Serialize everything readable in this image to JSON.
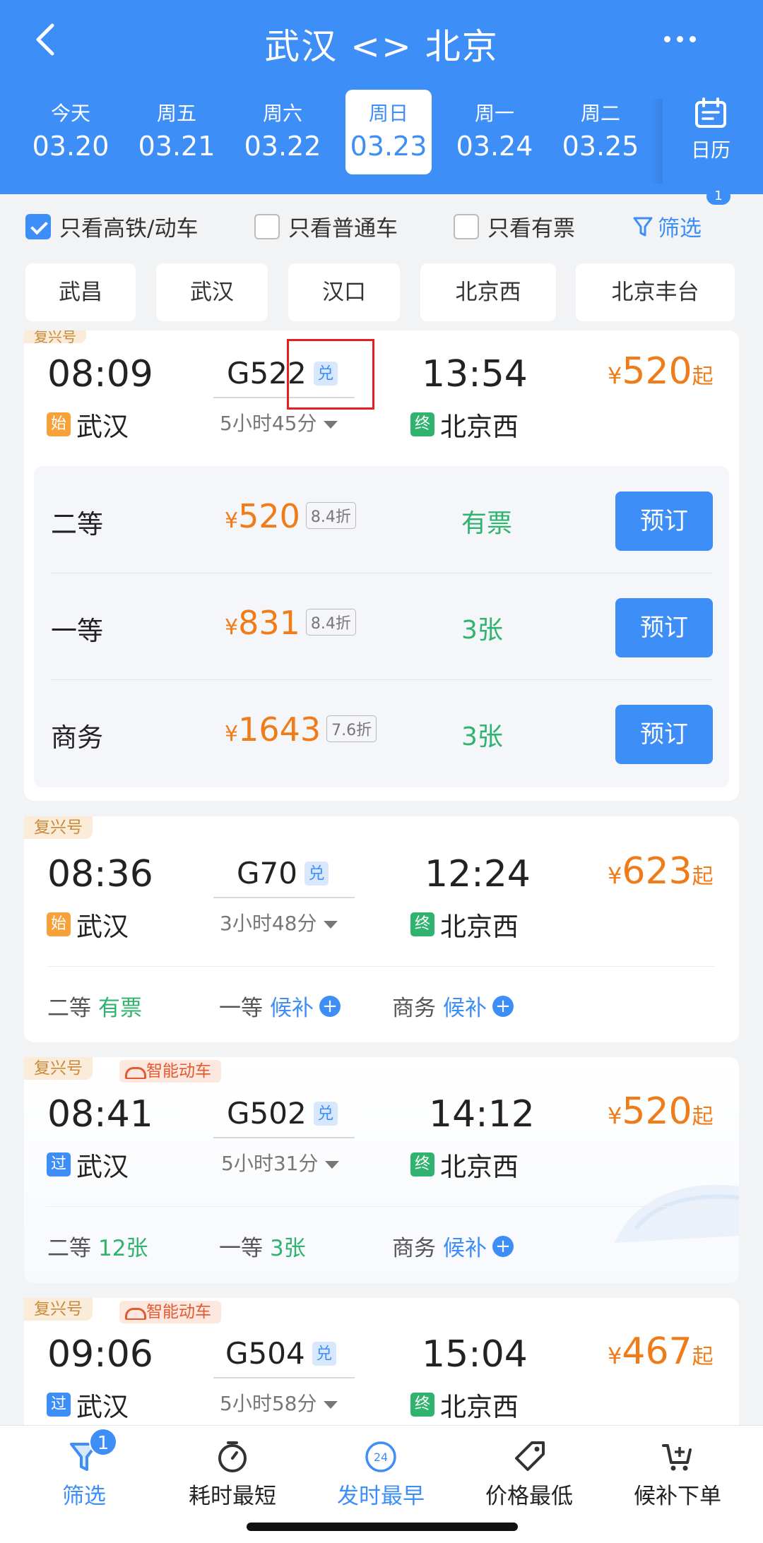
{
  "header": {
    "title": "武汉 <> 北京",
    "dates": [
      {
        "weekday": "今天",
        "date": "03.20"
      },
      {
        "weekday": "周五",
        "date": "03.21"
      },
      {
        "weekday": "周六",
        "date": "03.22"
      },
      {
        "weekday": "周日",
        "date": "03.23"
      },
      {
        "weekday": "周一",
        "date": "03.24"
      },
      {
        "weekday": "周二",
        "date": "03.25"
      }
    ],
    "selected_index": 3,
    "calendar_label": "日历"
  },
  "filters": {
    "high_speed_only": "只看高铁/动车",
    "normal_only": "只看普通车",
    "available_only": "只看有票",
    "filter_label": "筛选",
    "filter_count": "1"
  },
  "stations": [
    "武昌",
    "武汉",
    "汉口",
    "北京西",
    "北京丰台"
  ],
  "trains": [
    {
      "tags": [
        "复兴号"
      ],
      "depart_time": "08:09",
      "train_no": "G522",
      "exchange": "兑",
      "arrive_time": "13:54",
      "duration": "5小时45分",
      "from_badge": "始",
      "from": "武汉",
      "to_badge": "终",
      "to": "北京西",
      "price_yen": "¥",
      "price": "520",
      "price_suffix": "起",
      "seats": [
        {
          "name": "二等",
          "yen": "¥",
          "price": "520",
          "discount": "8.4折",
          "status": "有票",
          "action": "预订"
        },
        {
          "name": "一等",
          "yen": "¥",
          "price": "831",
          "discount": "8.4折",
          "status": "3张",
          "action": "预订"
        },
        {
          "name": "商务",
          "yen": "¥",
          "price": "1643",
          "discount": "7.6折",
          "status": "3张",
          "action": "预订"
        }
      ]
    },
    {
      "tags": [
        "复兴号"
      ],
      "depart_time": "08:36",
      "train_no": "G70",
      "exchange": "兑",
      "arrive_time": "12:24",
      "duration": "3小时48分",
      "from_badge": "始",
      "from": "武汉",
      "to_badge": "终",
      "to": "北京西",
      "price_yen": "¥",
      "price": "623",
      "price_suffix": "起",
      "summary": [
        {
          "class": "二等",
          "status": "有票"
        },
        {
          "class": "一等",
          "status": "候补"
        },
        {
          "class": "商务",
          "status": "候补"
        }
      ]
    },
    {
      "tags": [
        "复兴号",
        "智能动车"
      ],
      "depart_time": "08:41",
      "train_no": "G502",
      "exchange": "兑",
      "arrive_time": "14:12",
      "duration": "5小时31分",
      "from_badge": "过",
      "from": "武汉",
      "to_badge": "终",
      "to": "北京西",
      "price_yen": "¥",
      "price": "520",
      "price_suffix": "起",
      "summary": [
        {
          "class": "二等",
          "status": "12张"
        },
        {
          "class": "一等",
          "status": "3张"
        },
        {
          "class": "商务",
          "status": "候补"
        }
      ]
    },
    {
      "tags": [
        "复兴号",
        "智能动车"
      ],
      "depart_time": "09:06",
      "train_no": "G504",
      "exchange": "兑",
      "arrive_time": "15:04",
      "duration": "5小时58分",
      "from_badge": "过",
      "from": "武汉",
      "to_badge": "终",
      "to": "北京西",
      "price_yen": "¥",
      "price": "467",
      "price_suffix": "起"
    }
  ],
  "tabbar": {
    "badge": "1",
    "tabs": [
      {
        "label": "筛选",
        "icon": "filter-icon"
      },
      {
        "label": "耗时最短",
        "icon": "timer-icon"
      },
      {
        "label": "发时最早",
        "icon": "clock-24-icon"
      },
      {
        "label": "价格最低",
        "icon": "price-tag-icon"
      },
      {
        "label": "候补下单",
        "icon": "cart-icon"
      }
    ]
  },
  "colors": {
    "brand_blue": "#3e8ef7",
    "price_orange": "#f07c19",
    "available_green": "#2fb36e",
    "highlight_red": "#e42020"
  }
}
